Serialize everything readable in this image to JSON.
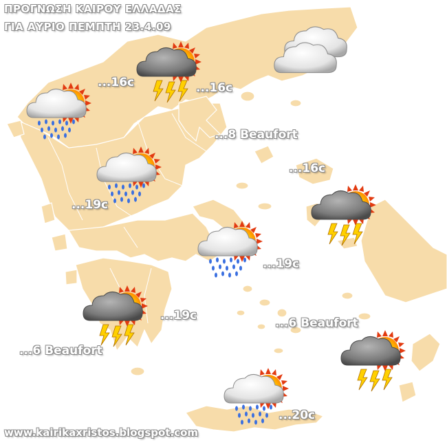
{
  "title": {
    "line1": "ΠΡΟΓΝΩΣΗ ΚΑΙΡΟΥ ΕΛΛΑΔΑΣ",
    "line2": "ΓΙΑ ΑΥΡΙΟ ΠΕΜΠΤΗ 23.4.09"
  },
  "colors": {
    "land": "#f7dcaa",
    "border": "#ffffff",
    "sea": "#ffffff",
    "sun": "#ffb000",
    "sun_rays": "#e03010",
    "cloud_dark": "#6e6e6e",
    "cloud_light": "#e4e4e4",
    "rain": "#3a6fe0",
    "lightning": "#ffd000"
  },
  "temperatures": [
    {
      "id": "macedonia-north",
      "text": "...16c"
    },
    {
      "id": "chalkidiki",
      "text": "...16c"
    },
    {
      "id": "lesvos",
      "text": "...16c"
    },
    {
      "id": "central-west",
      "text": "...19c"
    },
    {
      "id": "aegean-central",
      "text": "...19c"
    },
    {
      "id": "peloponnese",
      "text": "...19c"
    },
    {
      "id": "crete",
      "text": "...20c"
    }
  ],
  "winds": [
    {
      "id": "north-aegean",
      "text": "...8 Beaufort"
    },
    {
      "id": "south-aegean",
      "text": "...6 Beaufort"
    },
    {
      "id": "ionian",
      "text": "...6 Beaufort"
    }
  ],
  "weather_icons": [
    {
      "id": "thessaloniki",
      "icon": "sun-cloud-storm-icon"
    },
    {
      "id": "thrace",
      "icon": "clouds-icon"
    },
    {
      "id": "epirus",
      "icon": "sun-cloud-rain-icon"
    },
    {
      "id": "thessaly",
      "icon": "sun-cloud-rain-icon"
    },
    {
      "id": "lesvos",
      "icon": "sun-cloud-storm-icon"
    },
    {
      "id": "attica",
      "icon": "sun-cloud-rain-icon"
    },
    {
      "id": "peloponnese",
      "icon": "sun-cloud-storm-icon"
    },
    {
      "id": "dodecanese",
      "icon": "sun-cloud-storm-icon"
    },
    {
      "id": "crete",
      "icon": "sun-cloud-rain-icon"
    }
  ],
  "footer": "www.kairikaxristos.blogspot.com"
}
